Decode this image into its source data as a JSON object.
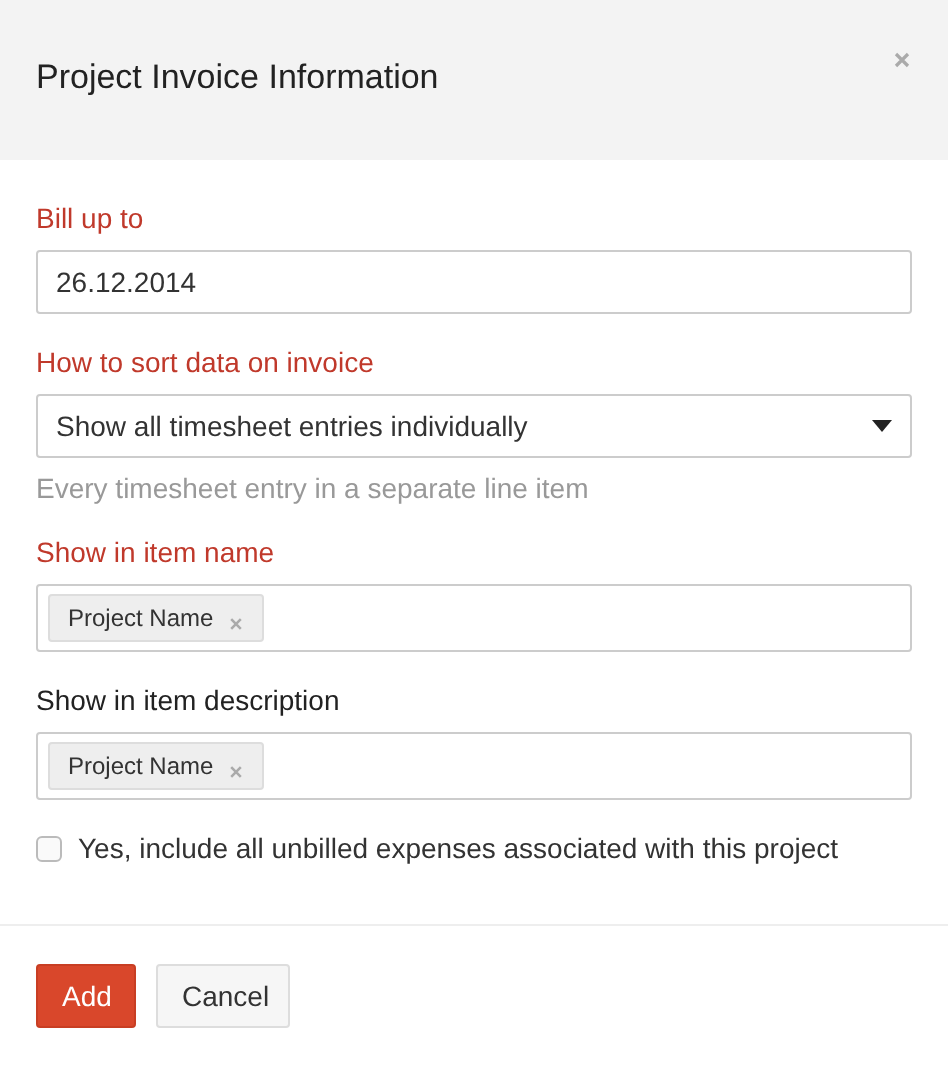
{
  "dialog": {
    "title": "Project Invoice Information"
  },
  "fields": [
    {
      "kind": "text",
      "label": "Bill up to",
      "required": true,
      "value": "26.12.2014"
    },
    {
      "kind": "select",
      "label": "How to sort data on invoice",
      "required": true,
      "value": "Show all timesheet entries individually",
      "hint": "Every timesheet entry in a separate line item"
    },
    {
      "kind": "tags",
      "label": "Show in item name",
      "required": true,
      "tags": [
        "Project Name"
      ]
    },
    {
      "kind": "tags",
      "label": "Show in item description",
      "required": false,
      "tags": [
        "Project Name"
      ]
    }
  ],
  "checkbox": {
    "label": "Yes, include all unbilled expenses associated with this project",
    "checked": false
  },
  "buttons": [
    {
      "label": "Add",
      "kind": "primary"
    },
    {
      "label": "Cancel",
      "kind": "secondary"
    }
  ]
}
